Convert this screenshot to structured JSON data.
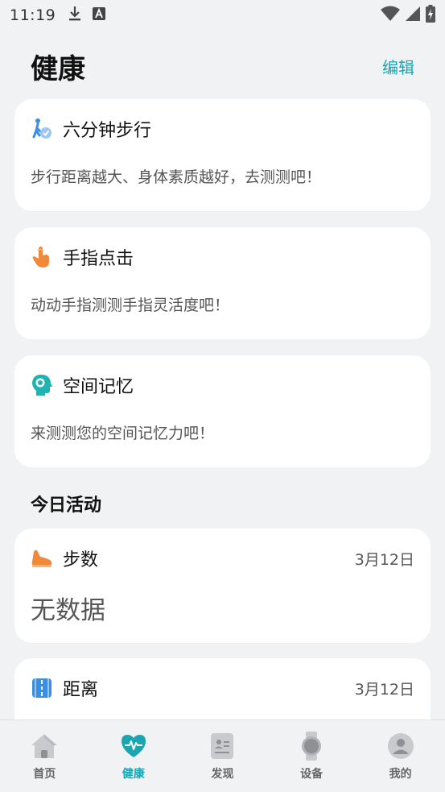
{
  "status": {
    "time": "11:19"
  },
  "header": {
    "title": "健康",
    "edit_label": "编辑"
  },
  "tests": [
    {
      "title": "六分钟步行",
      "desc": "步行距离越大、身体素质越好，去测测吧！",
      "icon": "walking-person-icon"
    },
    {
      "title": "手指点击",
      "desc": "动动手指测测手指灵活度吧！",
      "icon": "finger-tap-icon"
    },
    {
      "title": "空间记忆",
      "desc": "来测测您的空间记忆力吧！",
      "icon": "brain-head-icon"
    }
  ],
  "today": {
    "section_title": "今日活动",
    "steps": {
      "title": "步数",
      "date": "3月12日",
      "value": "无数据",
      "icon": "shoe-icon"
    },
    "distance": {
      "title": "距离",
      "date": "3月12日",
      "icon": "road-icon"
    }
  },
  "nav": [
    {
      "label": "首页",
      "icon": "home-icon",
      "active": false
    },
    {
      "label": "健康",
      "icon": "heart-pulse-icon",
      "active": true
    },
    {
      "label": "发现",
      "icon": "discover-card-icon",
      "active": false
    },
    {
      "label": "设备",
      "icon": "watch-icon",
      "active": false
    },
    {
      "label": "我的",
      "icon": "profile-icon",
      "active": false
    }
  ],
  "colors": {
    "accent": "#1aa5b0",
    "background": "#f1f2f4",
    "card": "#ffffff"
  }
}
